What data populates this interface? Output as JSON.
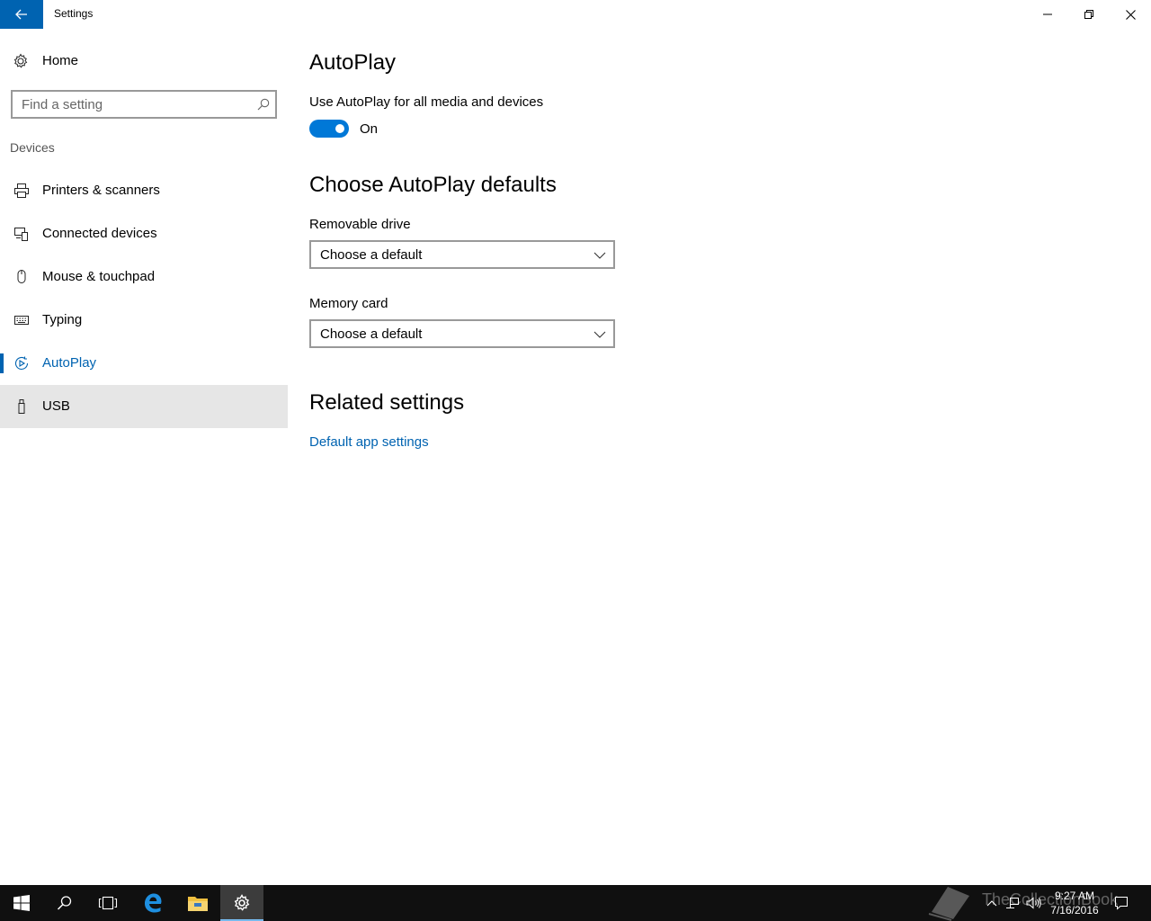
{
  "window": {
    "title": "Settings",
    "accent": "#0063b1"
  },
  "sidebar": {
    "home_label": "Home",
    "search_placeholder": "Find a setting",
    "section": "Devices",
    "items": [
      {
        "label": "Printers & scanners",
        "icon": "printer-icon"
      },
      {
        "label": "Connected devices",
        "icon": "connected-devices-icon"
      },
      {
        "label": "Mouse & touchpad",
        "icon": "mouse-icon"
      },
      {
        "label": "Typing",
        "icon": "keyboard-icon"
      },
      {
        "label": "AutoPlay",
        "icon": "autoplay-icon",
        "active": true
      },
      {
        "label": "USB",
        "icon": "usb-icon",
        "hovered": true
      }
    ]
  },
  "main": {
    "title": "AutoPlay",
    "toggle_caption": "Use AutoPlay for all media and devices",
    "toggle_state": "On",
    "defaults_heading": "Choose AutoPlay defaults",
    "removable_label": "Removable drive",
    "removable_value": "Choose a default",
    "memory_label": "Memory card",
    "memory_value": "Choose a default",
    "related_heading": "Related settings",
    "related_link": "Default app settings"
  },
  "taskbar": {
    "time": "9:27 AM",
    "date": "7/16/2016",
    "watermark": "TheCollectionBook",
    "active_app": "settings"
  }
}
